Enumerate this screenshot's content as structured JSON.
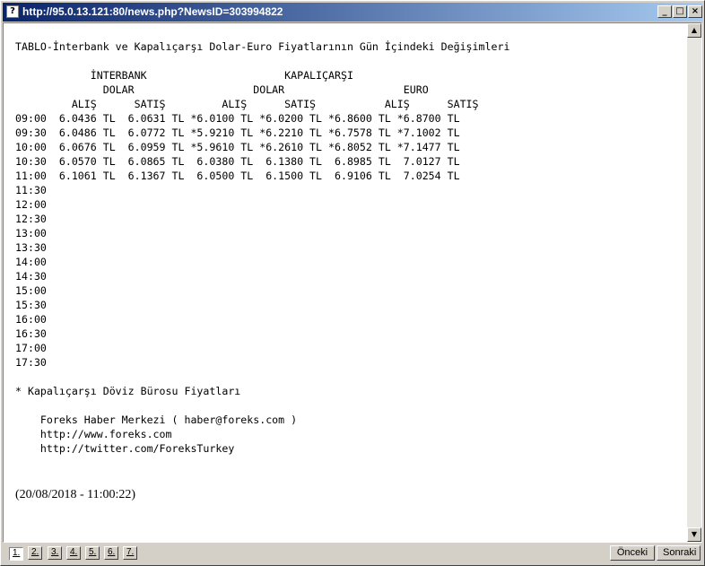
{
  "window": {
    "title": "http://95.0.13.121:80/news.php?NewsID=303994822",
    "app_icon_glyph": "?",
    "minimize_glyph": "_",
    "maximize_glyph": "□",
    "close_glyph": "×"
  },
  "news": {
    "body": "TABLO-İnterbank ve Kapalıçarşı Dolar-Euro Fiyatlarının Gün İçindeki Değişimleri\n\n            İNTERBANK                      KAPALIÇARŞI\n              DOLAR                   DOLAR                   EURO\n         ALIŞ      SATIŞ         ALIŞ      SATIŞ           ALIŞ      SATIŞ\n09:00  6.0436 TL  6.0631 TL *6.0100 TL *6.0200 TL *6.8600 TL *6.8700 TL\n09:30  6.0486 TL  6.0772 TL *5.9210 TL *6.2210 TL *6.7578 TL *7.1002 TL\n10:00  6.0676 TL  6.0959 TL *5.9610 TL *6.2610 TL *6.8052 TL *7.1477 TL\n10:30  6.0570 TL  6.0865 TL  6.0380 TL  6.1380 TL  6.8985 TL  7.0127 TL\n11:00  6.1061 TL  6.1367 TL  6.0500 TL  6.1500 TL  6.9106 TL  7.0254 TL\n11:30\n12:00\n12:30\n13:00\n13:30\n14:00\n14:30\n15:00\n15:30\n16:00\n16:30\n17:00\n17:30\n\n* Kapalıçarşı Döviz Bürosu Fiyatları\n\n    Foreks Haber Merkezi ( haber@foreks.com )\n    http://www.foreks.com\n    http://twitter.com/ForeksTurkey",
    "date": "(20/08/2018 - 11:00:22)"
  },
  "scrollbar": {
    "up_glyph": "▲",
    "down_glyph": "▼"
  },
  "pagination": {
    "pages": [
      "1.",
      "2.",
      "3.",
      "4.",
      "5.",
      "6.",
      "7."
    ],
    "prev_label": "Önceki",
    "next_label": "Sonraki"
  }
}
